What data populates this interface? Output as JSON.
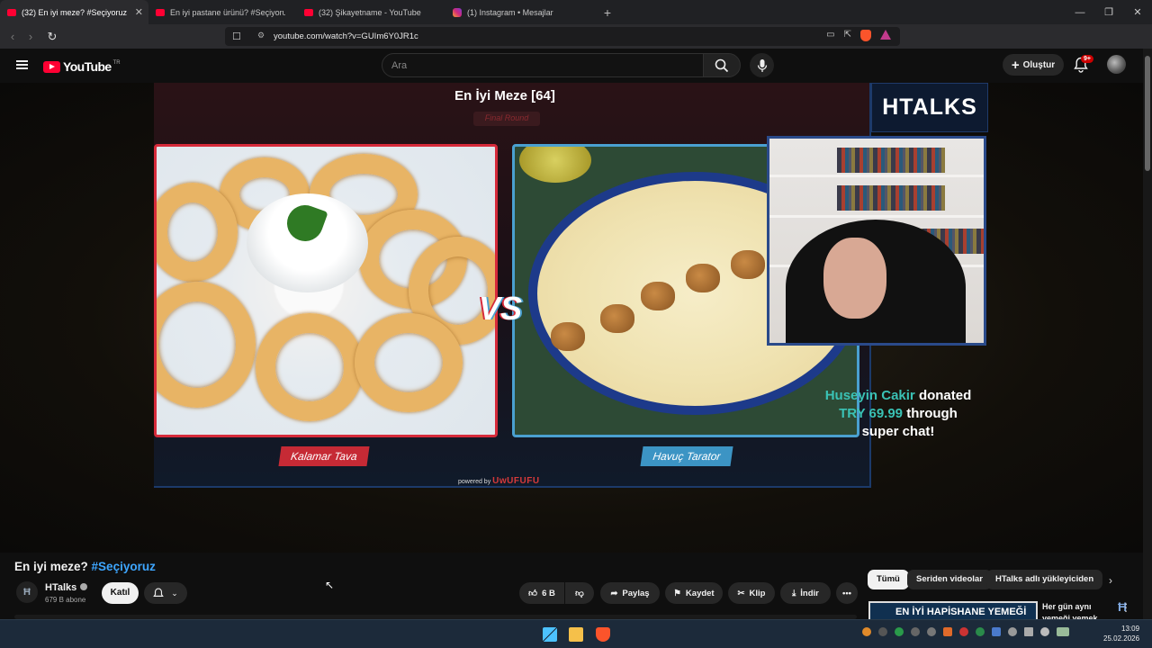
{
  "browser": {
    "tabs": [
      {
        "label": "(32) En iyi meze? #Seçiyoruz",
        "active": true,
        "icon": "youtube-icon"
      },
      {
        "label": "En iyi pastane ürünü? #Seçiyoruz - Yo",
        "active": false,
        "icon": "youtube-icon"
      },
      {
        "label": "(32) Şikayetname - YouTube",
        "active": false,
        "icon": "youtube-icon"
      },
      {
        "label": "(1) Instagram • Mesajlar",
        "active": false,
        "icon": "instagram-icon"
      }
    ],
    "url": "youtube.com/watch?v=GUIm6Y0JR1c"
  },
  "youtube": {
    "logo_text": "YouTube",
    "country_code": "TR",
    "search_placeholder": "Ara",
    "create_label": "Oluştur",
    "notification_badge": "9+"
  },
  "video_frame": {
    "title": "En İyi Meze [64]",
    "round": "Final Round",
    "left_option": "Kalamar Tava",
    "right_option": "Havuç Tarator",
    "versus": "VS",
    "powered_by": "powered by",
    "powered_brand": "UwUFUFU",
    "brand": "HTALKS",
    "donation": {
      "name": "Huseyin Cakir",
      "text1": "donated",
      "amount": "TRY 69.99",
      "text2": "through",
      "text3": "super chat!"
    }
  },
  "video_info": {
    "title": "En iyi meze?",
    "hashtag": "#Seçiyoruz",
    "channel": "HTalks",
    "subscribers": "679 B abone",
    "join_label": "Katıl",
    "likes": "6 B",
    "share_label": "Paylaş",
    "save_label": "Kaydet",
    "clip_label": "Klip",
    "download_label": "İndir"
  },
  "sidebar": {
    "chips": [
      "Tümü",
      "Seriden videolar",
      "HTalks adlı yükleyiciden"
    ],
    "rec_thumb_text": "EN İYİ HAPİSHANE YEMEĞİ",
    "rec_title_line1": "Her gün aynı",
    "rec_title_line2": "yemeği yemek..."
  },
  "taskbar": {
    "time": "13:09",
    "date": "25.02.2026"
  },
  "colors": {
    "youtube_red": "#ff0033",
    "link_blue": "#3ea6ff",
    "left_red": "#c62a35",
    "right_blue": "#3c94c4",
    "donation_teal": "#3ac2b5"
  }
}
